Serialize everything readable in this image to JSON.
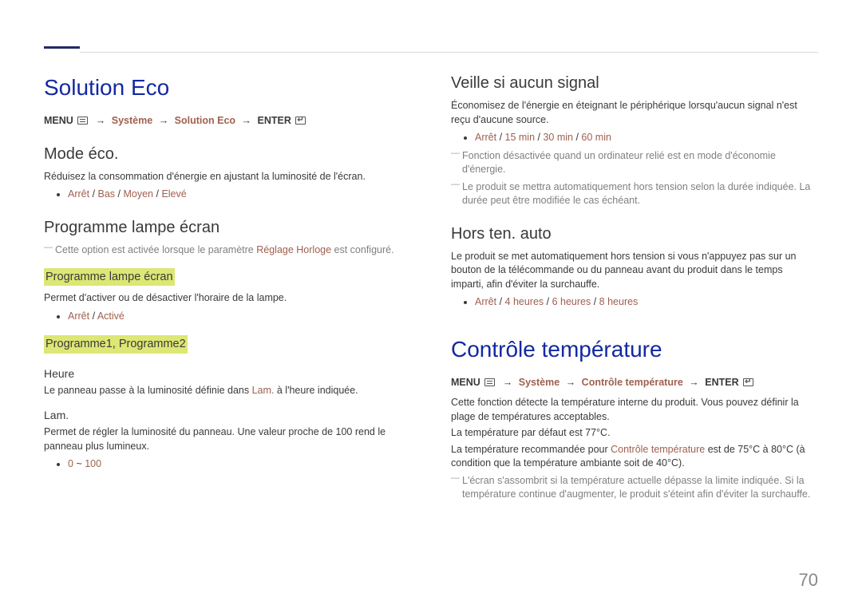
{
  "page_number": "70",
  "left": {
    "h1": "Solution Eco",
    "path1": {
      "menu": "MENU",
      "p1": "Système",
      "p2": "Solution Eco",
      "enter": "ENTER"
    },
    "mode_eco": {
      "title": "Mode éco.",
      "desc": "Réduisez la consommation d'énergie en ajustant la luminosité de l'écran.",
      "opts": {
        "a": "Arrêt",
        "b": "Bas",
        "c": "Moyen",
        "d": "Elevé"
      }
    },
    "lamp": {
      "title": "Programme lampe écran",
      "note_pre": "Cette option est activée lorsque le paramètre ",
      "note_hl": "Réglage Horloge",
      "note_post": " est configuré.",
      "sub1": {
        "title": "Programme lampe écran",
        "desc": "Permet d'activer ou de désactiver l'horaire de la lampe.",
        "opts": {
          "a": "Arrêt",
          "b": "Activé"
        }
      },
      "sub2": {
        "title": "Programme1, Programme2",
        "heure_label": "Heure",
        "heure_desc_pre": "Le panneau passe à la luminosité définie dans ",
        "heure_desc_hl": "Lam.",
        "heure_desc_post": " à l'heure indiquée.",
        "lam_label": "Lam.",
        "lam_desc": "Permet de régler la luminosité du panneau. Une valeur proche de 100 rend le panneau plus lumineux.",
        "range_a": "0",
        "range_sep": "~",
        "range_b": "100"
      }
    }
  },
  "right": {
    "standby": {
      "title": "Veille si aucun signal",
      "desc": "Économisez de l'énergie en éteignant le périphérique lorsqu'aucun signal n'est reçu d'aucune source.",
      "opts": {
        "a": "Arrêt",
        "b": "15 min",
        "c": "30 min",
        "d": "60 min"
      },
      "note1": "Fonction désactivée quand un ordinateur relié est en mode d'économie d'énergie.",
      "note2": "Le produit se mettra automatiquement hors tension selon la durée indiquée. La durée peut être modifiée le cas échéant."
    },
    "auto_off": {
      "title": "Hors ten. auto",
      "desc": "Le produit se met automatiquement hors tension si vous n'appuyez pas sur un bouton de la télécommande ou du panneau avant du produit dans le temps imparti, afin d'éviter la surchauffe.",
      "opts": {
        "a": "Arrêt",
        "b": "4 heures",
        "c": "6 heures",
        "d": "8 heures"
      }
    },
    "h1": "Contrôle température",
    "path2": {
      "menu": "MENU",
      "p1": "Système",
      "p2": "Contrôle température",
      "enter": "ENTER"
    },
    "temp": {
      "desc1": "Cette fonction détecte la température interne du produit. Vous pouvez définir la plage de températures acceptables.",
      "desc2": "La température par défaut est 77°C.",
      "desc3_pre": "La température recommandée pour ",
      "desc3_hl": "Contrôle température",
      "desc3_post": " est de 75°C à 80°C (à condition que la température ambiante soit de 40°C).",
      "note": "L'écran s'assombrit si la température actuelle dépasse la limite indiquée. Si la température continue d'augmenter, le produit s'éteint afin d'éviter la surchauffe."
    }
  }
}
